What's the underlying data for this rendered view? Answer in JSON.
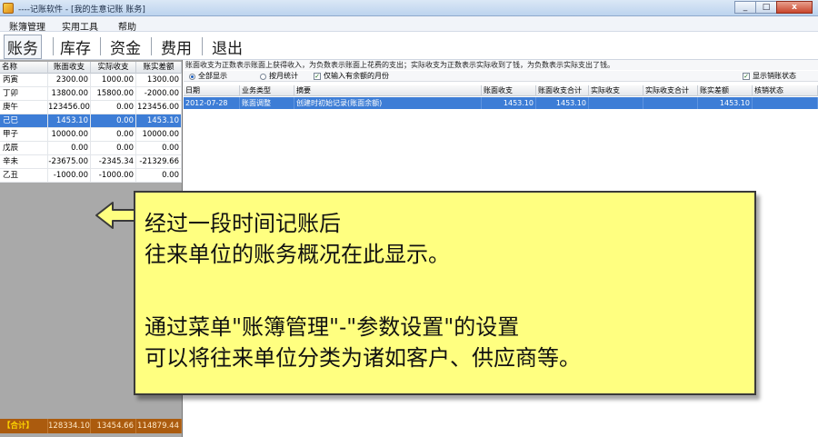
{
  "window": {
    "title": "----记账软件 - [我的生意记账 账务]",
    "minimize": "_",
    "maximize": "□",
    "close": "x"
  },
  "menu": [
    "账簿管理",
    "实用工具",
    "帮助"
  ],
  "toolbar": [
    "账务",
    "库存",
    "资金",
    "费用",
    "退出"
  ],
  "left_panel": {
    "headers": [
      "名称",
      "账面收支",
      "实际收支",
      "账实差额"
    ],
    "rows": [
      {
        "name": "丙寅",
        "book": "2300.00",
        "actual": "1000.00",
        "diff": "1300.00"
      },
      {
        "name": "丁卯",
        "book": "13800.00",
        "actual": "15800.00",
        "diff": "-2000.00"
      },
      {
        "name": "庚午",
        "book": "123456.00",
        "actual": "0.00",
        "diff": "123456.00"
      },
      {
        "name": "己巳",
        "book": "1453.10",
        "actual": "0.00",
        "diff": "1453.10",
        "selected": true
      },
      {
        "name": "甲子",
        "book": "10000.00",
        "actual": "0.00",
        "diff": "10000.00"
      },
      {
        "name": "戊辰",
        "book": "0.00",
        "actual": "0.00",
        "diff": "0.00"
      },
      {
        "name": "辛未",
        "book": "-23675.00",
        "actual": "-2345.34",
        "diff": "-21329.66"
      },
      {
        "name": "乙丑",
        "book": "-1000.00",
        "actual": "-1000.00",
        "diff": "0.00"
      }
    ],
    "footer": {
      "label": "【合计】",
      "book": "128334.10",
      "actual": "13454.66",
      "diff": "114879.44"
    }
  },
  "main": {
    "info": "账面收支为正数表示账面上获得收入，为负数表示账面上花费的支出；实际收支为正数表示实际收到了钱，为负数表示实际支出了钱。",
    "options": {
      "show_all": "全部显示",
      "period_stats": "按月统计",
      "include_filter": "仅输入有余额的月份",
      "show_settled": "显示销账状态"
    },
    "headers": [
      "日期",
      "业务类型",
      "摘要",
      "账面收支",
      "账面收支合计",
      "实际收支",
      "实际收支合计",
      "账实差额",
      "核销状态"
    ],
    "rows": [
      {
        "date": "2012-07-28",
        "type": "账面调整",
        "summary": "创建时初始记录(账面余额)",
        "book": "1453.10",
        "book_total": "1453.10",
        "actual": "",
        "actual_total": "",
        "diff": "1453.10",
        "status": ""
      }
    ]
  },
  "callout": {
    "lines": [
      "经过一段时间记账后",
      "往来单位的账务概况在此显示。",
      "",
      "通过菜单\"账簿管理\"-\"参数设置\"的设置",
      "可以将往来单位分类为诸如客户、供应商等。"
    ]
  }
}
